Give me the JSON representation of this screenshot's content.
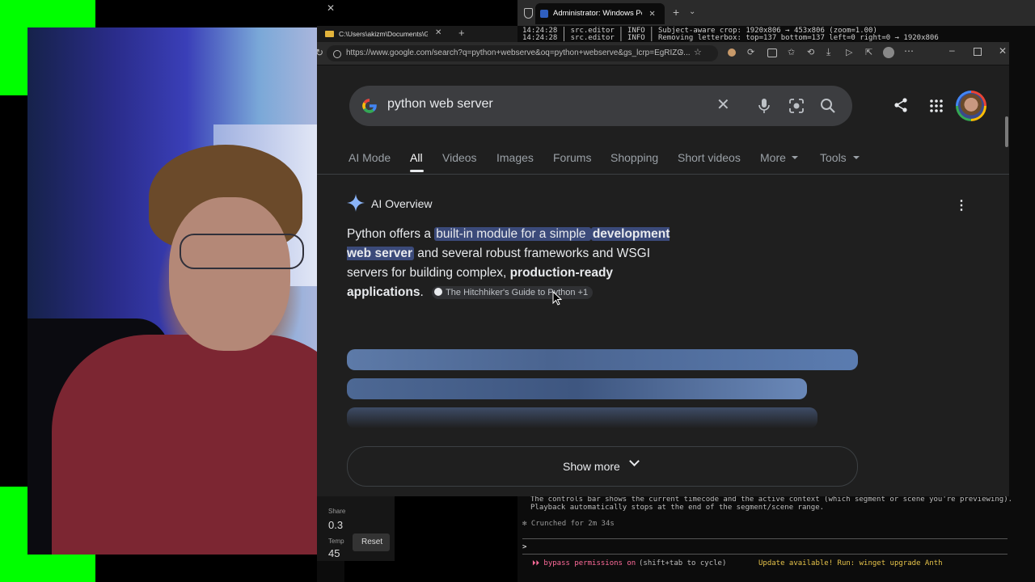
{
  "browser": {
    "tab_title": "C:\\Users\\akizm\\Documents\\G",
    "url": "https://www.google.com/search?q=python+webserve&oq=python+webserve&gs_lcrp=EgRIZG..."
  },
  "search": {
    "query": "python web server",
    "tabs": [
      "AI Mode",
      "All",
      "Videos",
      "Images",
      "Forums",
      "Shopping",
      "Short videos",
      "More",
      "Tools"
    ],
    "active_tab": "All"
  },
  "ai_overview": {
    "heading": "AI Overview",
    "p1": "Python offers a ",
    "p2": "built-in module for a simple ",
    "p3": "development web server",
    "p4": " and several robust frameworks and WSGI servers for building complex, ",
    "p5": "production-ready applications",
    "p6": ".",
    "source": "The Hitchhiker's Guide to Python +1",
    "show_more": "Show more"
  },
  "terminal": {
    "tab_title": "Administrator: Windows Powe",
    "line1": "14:24:28 | src.editor          | INFO     | Subject-aware crop: 1920x806 → 453x806 (zoom=1.00)",
    "line2": "14:24:28 | src.editor          | INFO     | Removing letterbox: top=137 bottom=137 left=0 right=0 → 1920x806",
    "note1": "The controls bar shows the current timecode and the active context (which segment or scene you're previewing).",
    "note2": "Playback automatically stops at the end of the segment/scene range.",
    "crunched": "✻ Crunched for 2m 34s",
    "prompt": ">",
    "bypass": "⏵⏵ bypass permissions on",
    "bypass_hint": " (shift+tab to cycle)",
    "update": "Update available! Run: winget upgrade Anth"
  },
  "panel": {
    "label1": "Share",
    "value1": "0.3",
    "label2": "Temp",
    "value2": "45",
    "reset": "Reset"
  },
  "colors": {
    "accent": "#8ab4f8",
    "highlight": "#3b4a7a",
    "green_screen": "#00ff00"
  }
}
